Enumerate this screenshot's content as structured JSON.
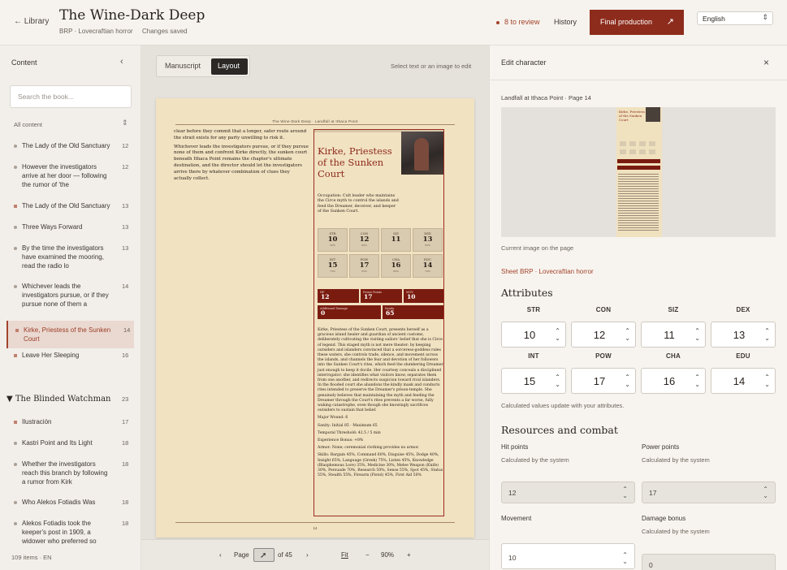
{
  "header": {
    "back": "← Library",
    "title": "The Wine-Dark Deep",
    "subtitle": "BRP · Lovecraftian horror",
    "status": "Changes saved",
    "review": "8 to review",
    "history": "History",
    "final": "Final production",
    "final_icon": "↗",
    "lang": "English"
  },
  "sidebar": {
    "title": "Content",
    "collapse": "‹",
    "search_placeholder": "Search the book...",
    "all": "All content",
    "all_icon": "⇕",
    "items": [
      {
        "label": "The Lady of the Old Sanctuary",
        "num": "12"
      },
      {
        "label": "However the investigators arrive at her door — following the rumor of 'the",
        "num": "12"
      },
      {
        "label": "The Lady of the Old Sanctuary",
        "num": "13"
      },
      {
        "label": "Three Ways Forward",
        "num": "13"
      },
      {
        "label": "By the time the investigators have examined the mooring, read the radio lo",
        "num": "13"
      },
      {
        "label": "Whichever leads the investigators pursue, or if they pursue none of them a",
        "num": "14"
      },
      {
        "label": "Kirke, Priestess of the Sunken Court",
        "num": "14"
      },
      {
        "label": "Leave Her Sleeping",
        "num": "16"
      }
    ],
    "chapter": {
      "label": "▼ The Blinded Watchman",
      "num": "23"
    },
    "items2": [
      {
        "label": "Ilustración",
        "num": "17"
      },
      {
        "label": "Kastri Point and Its Light",
        "num": "18"
      },
      {
        "label": "Whether the investigators reach this branch by following a rumor from Kirk",
        "num": "18"
      },
      {
        "label": "Who Alekos Fotiadis Was",
        "num": "18"
      },
      {
        "label": "Alekos Fotiadis took the keeper's post in 1909, a widower who preferred so",
        "num": "18"
      }
    ],
    "footer": "109 items · EN"
  },
  "center": {
    "mode_manuscript": "Manuscript",
    "mode_layout": "Layout",
    "hint": "Select text or an image to edit",
    "page": {
      "runhead": "The Wine-Dark Deep · Landfall at Ithaca Point",
      "left_p1": "clear before they commit that a longer, safer route around the strait exists for any party unwilling to risk it.",
      "left_p2": "Whichever leads the investigators pursue, or if they pursue none of them and confront Kirke directly, the sunken court beneath Ithaca Point remains the chapter's ultimate destination, and the director should let the investigators arrive there by whatever combination of clues they actually collect.",
      "card_title": "Kirke, Priestess of the Sunken Court",
      "occupation": "Occupation: Cult leader who maintains the Circe myth to control the islands and feed the Dreamer, deceiver, and keeper of the Sunken Court.",
      "stats": [
        {
          "l": "STR",
          "v": "10",
          "p": "50%"
        },
        {
          "l": "CON",
          "v": "12",
          "p": "60%"
        },
        {
          "l": "SIZ",
          "v": "11",
          "p": ""
        },
        {
          "l": "DEX",
          "v": "13",
          "p": "65%"
        },
        {
          "l": "INT",
          "v": "15",
          "p": "75%"
        },
        {
          "l": "POW",
          "v": "17",
          "p": "85%"
        },
        {
          "l": "CHA",
          "v": "16",
          "p": "80%"
        },
        {
          "l": "EDU",
          "v": "14",
          "p": "70%"
        }
      ],
      "res": [
        {
          "l": "HP",
          "v": "12"
        },
        {
          "l": "Power Points",
          "v": "17"
        },
        {
          "l": "MOV",
          "v": "10"
        },
        {
          "l": "Additional Damage",
          "v": "0"
        },
        {
          "l": "Sanity",
          "v": "65"
        }
      ],
      "desc": "Kirke, Priestess of the Sunken Court, presents herself as a gracious island healer and guardian of ancient customs, deliberately cultivating the visiting sailors' belief that she is Circe of legend. This staged myth is not mere theater: by keeping outsiders and islanders convinced that a sorceress-goddess rules these waters, she controls trade, silence, and movement across the islands, and channels the fear and devotion of her followers into the Sunken Court's rites, which feed the slumbering Dreamer just enough to keep it docile. Her courtesy conceals a disciplined interrogator: she identifies what visitors know, separates them from one another, and redirects suspicion toward rival islanders. In the flooded court she abandons the kindly mask and conducts rites intended to preserve the Dreamer's prison-temple. She genuinely believes that maintaining the myth and feeding the Dreamer through the Court's rites prevents a far worse, fully waking catastrophe, even though she knowingly sacrifices outsiders to sustain that belief.",
      "wound": "Major Wound: 6",
      "sanity": "Sanity: Initial 85 · Maximum 65",
      "temporal": "Temporal Threshold: 42.5 / 5 min",
      "exp": "Experience Bonus: +8%",
      "armor": "Armor: None; ceremonial clothing provides no armor.",
      "skills": "Skills: Bargain 45%, Command 60%, Disguise 45%, Dodge 40%, Insight 65%, Language (Greek) 75%, Listen 45%, Knowledge (Blasphemous Lore) 35%, Medicine 30%, Melee Weapon (Knife) 30%, Persuade 70%, Research 50%, Sense 55%, Spot 45%, Status 55%, Stealth 55%, Firearm (Pistol) 45%, First Aid 50%",
      "pagenum": "14"
    },
    "pager": {
      "prev": "‹",
      "label": "Page",
      "of": "of 45",
      "next": "›",
      "fit": "Fit",
      "minus": "−",
      "zoom": "90%",
      "plus": "+"
    }
  },
  "panel": {
    "title": "Edit character",
    "close": "×",
    "crumb": "Landfall at Ithaca Point · Page 14",
    "current": "Current image on the page",
    "sheet": "Sheet BRP · Lovecraftian horror",
    "attributes_title": "Attributes",
    "attrs": [
      {
        "l": "STR",
        "v": "10"
      },
      {
        "l": "CON",
        "v": "12"
      },
      {
        "l": "SIZ",
        "v": "11"
      },
      {
        "l": "DEX",
        "v": "13"
      },
      {
        "l": "INT",
        "v": "15"
      },
      {
        "l": "POW",
        "v": "17"
      },
      {
        "l": "CHA",
        "v": "16"
      },
      {
        "l": "EDU",
        "v": "14"
      }
    ],
    "calc_note": "Calculated values update with your attributes.",
    "resources_title": "Resources and combat",
    "hp_label": "Hit points",
    "hp_sub": "Calculated by the system",
    "hp": "12",
    "pp_label": "Power points",
    "pp_sub": "Calculated by the system",
    "pp": "17",
    "mov_label": "Movement",
    "mov": "10",
    "db_label": "Damage bonus",
    "db_sub": "Calculated by the system",
    "db": "0"
  },
  "colors": {
    "accent": "#8d2c1c",
    "page": "#f1e2c2",
    "review": "#a3432c"
  }
}
